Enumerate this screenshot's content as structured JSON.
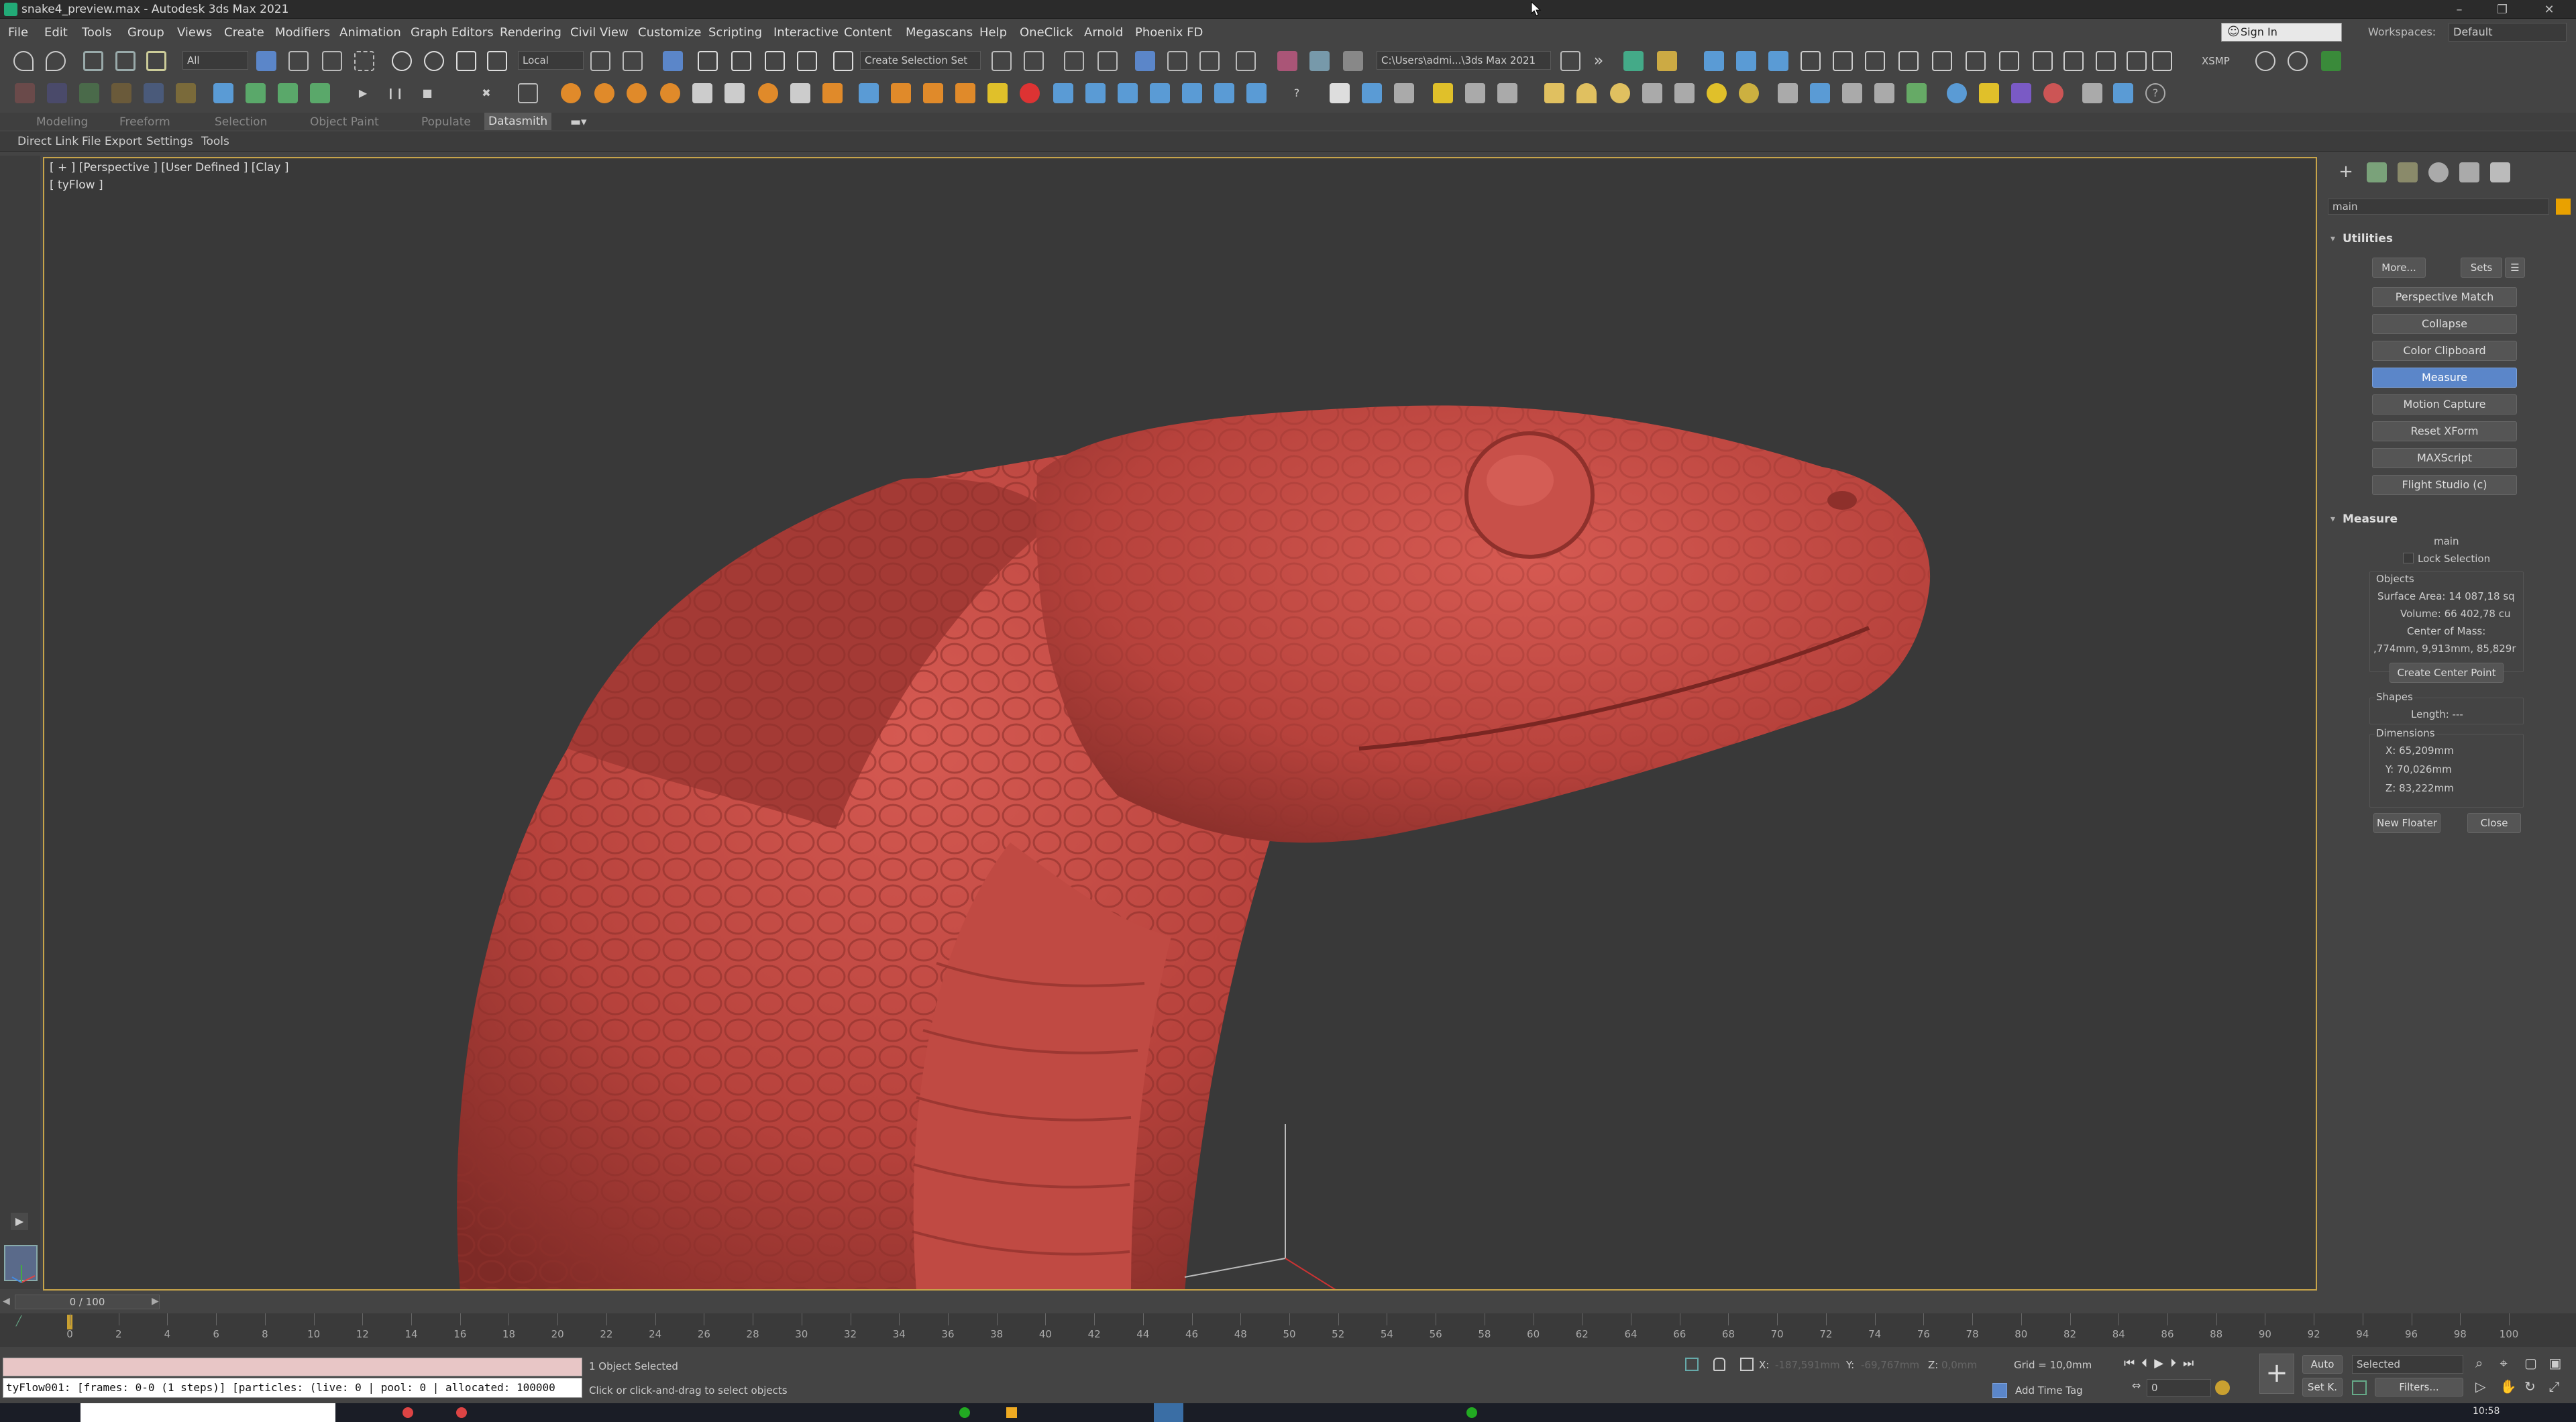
{
  "window": {
    "title": "snake4_preview.max - Autodesk 3ds Max 2021"
  },
  "menu": {
    "items": [
      "File",
      "Edit",
      "Tools",
      "Group",
      "Views",
      "Create",
      "Modifiers",
      "Animation",
      "Graph Editors",
      "Rendering",
      "Civil View",
      "Customize",
      "Scripting",
      "Interactive",
      "Content",
      "Megascans",
      "Help",
      "OneClick",
      "Arnold",
      "Phoenix FD"
    ],
    "sign_in": "Sign In",
    "workspaces_label": "Workspaces:",
    "workspace_value": "Default"
  },
  "toolbar": {
    "filter_value": "All",
    "coord_value": "Local",
    "selection_set": "Create Selection Set",
    "project_path": "C:\\Users\\admi...\\3ds Max 2021",
    "xsmp": "XSMP"
  },
  "ribbon": {
    "tabs": [
      "Modeling",
      "Freeform",
      "Selection",
      "Object Paint",
      "Populate",
      "Datasmith"
    ],
    "active_tab": "Datasmith",
    "sub_tabs": [
      "Direct Link",
      "File Export",
      "Settings",
      "Tools"
    ]
  },
  "viewport": {
    "label": "[ + ] [Perspective ] [User Defined ] [Clay ]",
    "sub_label": "[ tyFlow ]",
    "colors": {
      "model": "#c0453f",
      "background": "#393939",
      "active_border": "#c7a44a"
    }
  },
  "command_panel": {
    "object_name": "main",
    "utilities_title": "Utilities",
    "more_label": "More...",
    "sets_label": "Sets",
    "utility_buttons": [
      "Perspective Match",
      "Collapse",
      "Color Clipboard",
      "Measure",
      "Motion Capture",
      "Reset XForm",
      "MAXScript",
      "Flight Studio (c)"
    ],
    "active_utility": "Measure",
    "measure": {
      "title": "Measure",
      "object": "main",
      "lock_selection": "Lock Selection",
      "objects_group": "Objects",
      "surface_area": "Surface Area: 14 087,18 sq",
      "volume": "Volume: 66 402,78 cu",
      "center_of_mass_label": "Center of Mass:",
      "center_of_mass": ",774mm, 9,913mm, 85,829r",
      "create_center_point": "Create Center Point",
      "shapes_group": "Shapes",
      "length": "Length: ---",
      "dimensions_group": "Dimensions",
      "dim_x": "X:  65,209mm",
      "dim_y": "Y:  70,026mm",
      "dim_z": "Z:  83,222mm",
      "new_floater": "New Floater",
      "close": "Close"
    }
  },
  "timeline": {
    "slider_label": "0 / 100",
    "ticks": [
      "0",
      "2",
      "4",
      "6",
      "8",
      "10",
      "12",
      "14",
      "16",
      "18",
      "20",
      "22",
      "24",
      "26",
      "28",
      "30",
      "32",
      "34",
      "36",
      "38",
      "40",
      "42",
      "44",
      "46",
      "48",
      "50",
      "52",
      "54",
      "56",
      "58",
      "60",
      "62",
      "64",
      "66",
      "68",
      "70",
      "72",
      "74",
      "76",
      "78",
      "80",
      "82",
      "84",
      "86",
      "88",
      "90",
      "92",
      "94",
      "96",
      "98",
      "100"
    ]
  },
  "status": {
    "maxscript_output": "tyFlow001: [frames: 0-0 (1 steps)] [particles: (live: 0 | pool: 0 | allocated: 100000",
    "selection_info": "1 Object Selected",
    "prompt": "Click or click-and-drag to select objects",
    "x_label": "X:",
    "x_value": "-187,591mm",
    "y_label": "Y:",
    "y_value": "-69,767mm",
    "z_label": "Z:",
    "z_value": "0,0mm",
    "grid": "Grid = 10,0mm",
    "add_time_tag": "Add Time Tag",
    "auto_label": "Auto",
    "setk_label": "Set K.",
    "selected_dd": "Selected",
    "frame_value": "0",
    "filters_label": "Filters...",
    "clock": "10:58"
  }
}
